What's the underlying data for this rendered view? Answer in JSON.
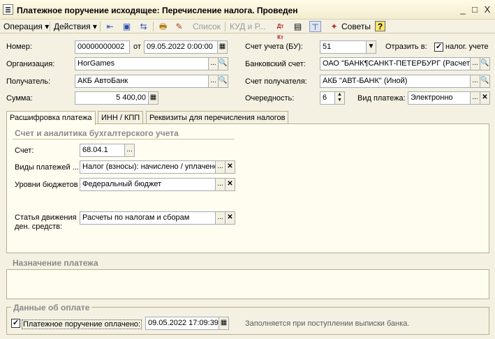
{
  "window": {
    "title": "Платежное поручение исходящее: Перечисление налога. Проведен",
    "minimize": "_",
    "maximize": "□",
    "close": "X"
  },
  "toolbar": {
    "operation": "Операция ▾",
    "actions": "Действия ▾",
    "list": "Список",
    "kud": "КУД и Р...",
    "dt_kt": "Дт Кт",
    "advice": "Советы",
    "help": "?"
  },
  "header": {
    "number_label": "Номер:",
    "number_value": "00000000002",
    "from_label": "от",
    "date_value": "09.05.2022  0:00:00",
    "org_label": "Организация:",
    "org_value": "HorGames",
    "recipient_label": "Получатель:",
    "recipient_value": "АКБ АвтоБанк",
    "sum_label": "Сумма:",
    "sum_value": "5 400,00",
    "account_bu_label": "Счет учета (БУ):",
    "account_bu_value": "51",
    "reflect_label": "Отразить в:",
    "reflect_checkbox_label": "налог. учете",
    "reflect_checked": true,
    "bank_account_label": "Банковский счет:",
    "bank_account_value": "ОАО \"БАНК¶САНКТ-ПЕТЕРБУРГ (Расчет",
    "recipient_account_label": "Счет получателя:",
    "recipient_account_value": "АКБ \"АВТ-БАНК\" (Иной)",
    "priority_label": "Очередность:",
    "priority_value": "6",
    "payment_type_label": "Вид платежа:",
    "payment_type_value": "Электронно"
  },
  "tabs": [
    {
      "label": "Расшифровка платежа",
      "active": true
    },
    {
      "label": "ИНН / КПП",
      "active": false
    },
    {
      "label": "Реквизиты для перечисления налогов",
      "active": false
    }
  ],
  "accounting": {
    "section_title": "Счет и аналитика бухгалтерского учета",
    "account_label": "Счет:",
    "account_value": "68.04.1",
    "payment_kinds_label": "Виды платежей ...",
    "payment_kinds_value": "Налог (взносы): начислено / уплачено",
    "budget_levels_label": "Уровни бюджетов",
    "budget_levels_value": "Федеральный бюджет",
    "cashflow_label_1": "Статья движения",
    "cashflow_label_2": "ден. средств:",
    "cashflow_value": "Расчеты по налогам и сборам"
  },
  "purpose": {
    "section_title": "Назначение платежа",
    "text": ""
  },
  "payment": {
    "section_title": "Данные об оплате",
    "paid_label": "Платежное поручение оплачено:",
    "paid_checked": true,
    "paid_date": "09.05.2022 17:09:39",
    "hint": "Заполняется при поступлении выписки банка."
  }
}
